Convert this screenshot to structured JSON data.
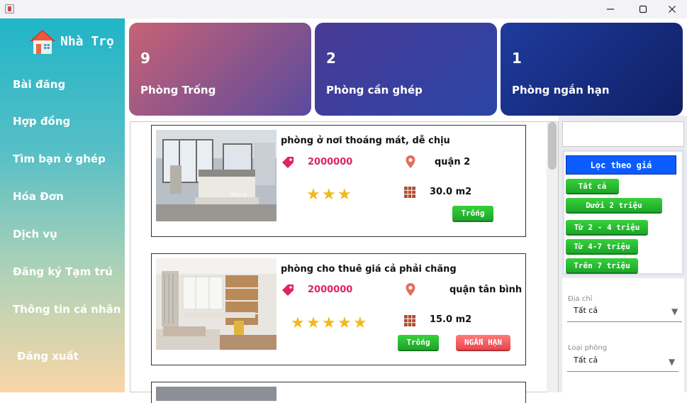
{
  "window": {
    "minimize_icon": "minimize-icon",
    "maximize_icon": "maximize-icon",
    "close_icon": "close-icon"
  },
  "sidebar": {
    "app_name": "Nhà Trọ",
    "items": [
      {
        "label": "Bài đăng"
      },
      {
        "label": "Hợp đồng"
      },
      {
        "label": "Tìm bạn ở ghép"
      },
      {
        "label": "Hóa Đơn"
      },
      {
        "label": "Dịch vụ"
      },
      {
        "label": "Đăng ký Tạm trú"
      },
      {
        "label": "Thông tin cá nhân"
      }
    ],
    "logout": "Đăng xuất"
  },
  "stats": [
    {
      "count": "9",
      "label": "Phòng Trống",
      "color_start": "#c86274",
      "color_end": "#5a4a9e"
    },
    {
      "count": "2",
      "label": "Phòng cần ghép",
      "color_start": "#4a3a96",
      "color_end": "#2a45a6"
    },
    {
      "count": "1",
      "label": "Phòng ngắn hạn",
      "color_start": "#1e3b9e",
      "color_end": "#0f1f63"
    }
  ],
  "rooms": [
    {
      "title": "phòng ở nơi thoáng mát, dễ chịu",
      "price": "2000000",
      "location": "quận 2",
      "area": "30.0 m2",
      "stars": 3,
      "status_buttons": [
        "Trống"
      ]
    },
    {
      "title": "phòng cho thuê  giá cả phải chăng",
      "price": "2000000",
      "location": "quận tân bình",
      "area": "15.0 m2",
      "stars": 5,
      "status_buttons": [
        "Trống",
        "NGẮN HẠN"
      ]
    }
  ],
  "filters": {
    "price_header": "Lọc theo giá",
    "price_options": [
      "Tất cả",
      "Dưới 2 triệu",
      "Từ 2 - 4 triệu",
      "Từ 4-7 triệu",
      "Trên 7 triệu"
    ],
    "address_label": "Địa chỉ",
    "address_value": "Tất cả",
    "room_type_label": "Loại phòng",
    "room_type_value": "Tất cả"
  }
}
